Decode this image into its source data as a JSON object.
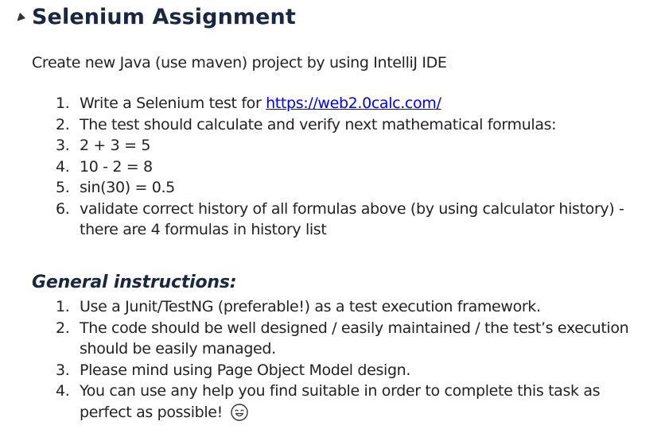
{
  "page": {
    "title": "Selenium Assignment",
    "collapse_icon": "collapse-triangle-icon"
  },
  "intro": "Create new Java (use maven) project by using IntelliJ IDE",
  "steps": [
    {
      "num": "1.",
      "text_before": "Write a Selenium test for ",
      "link": "https://web2.0calc.com/"
    },
    {
      "num": "2.",
      "text": "The test should calculate and verify next mathematical formulas:"
    },
    {
      "num": "3.",
      "text": "2 + 3 = 5"
    },
    {
      "num": "4.",
      "text": "10 - 2 = 8"
    },
    {
      "num": "5.",
      "text": "sin(30) = 0.5"
    },
    {
      "num": "6.",
      "text": "validate correct history of all formulas above (by using calculator history) - there are 4 formulas in history list"
    }
  ],
  "general": {
    "heading": "General instructions:",
    "items": [
      {
        "num": "1.",
        "text": "Use a Junit/TestNG (preferable!) as a test execution framework."
      },
      {
        "num": "2.",
        "text": "The code should be well designed / easily maintained / the test’s execution should be easily managed."
      },
      {
        "num": "3.",
        "text": "Please mind using Page Object Model design."
      },
      {
        "num": "4.",
        "text": "You can use any help you find suitable in order to complete this task as perfect as possible!",
        "emoji": "smiling-face-icon"
      }
    ]
  },
  "colors": {
    "heading": "#1a2740",
    "body_text": "#222222",
    "link": "#0000ee"
  }
}
